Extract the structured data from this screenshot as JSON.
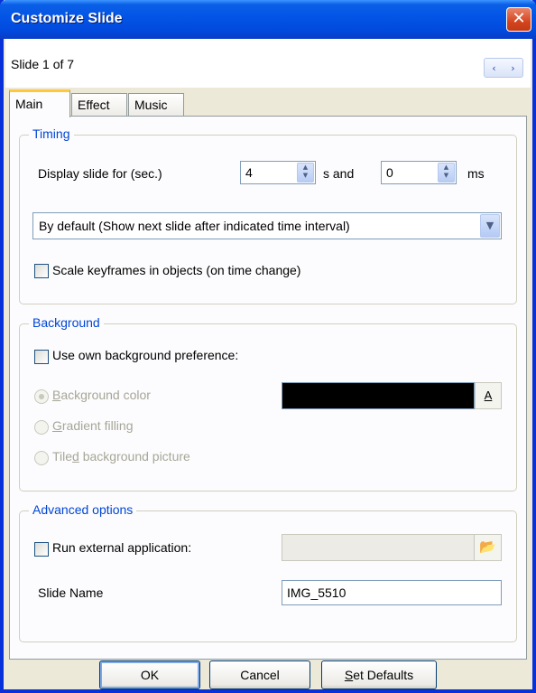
{
  "window": {
    "title": "Customize Slide",
    "close_glyph": "✕"
  },
  "slide_info": {
    "label": "Slide 1 of 7",
    "prev_glyph": "‹",
    "next_glyph": "›"
  },
  "tabs": [
    {
      "label": "Main",
      "active": true
    },
    {
      "label": "Effect",
      "active": false
    },
    {
      "label": "Music",
      "active": false
    }
  ],
  "timing": {
    "title": "Timing",
    "display_label": "Display slide for (sec.)",
    "seconds_value": "4",
    "seconds_unit": "s and",
    "ms_value": "0",
    "ms_unit": "ms",
    "mode_selected": "By default (Show next slide after indicated time interval)",
    "scale_keyframes_label": "Scale keyframes in objects (on time change)",
    "scale_keyframes_checked": false
  },
  "background": {
    "title": "Background",
    "use_own_label": "Use own background preference:",
    "use_own_checked": false,
    "options": [
      {
        "prefix": "",
        "accel": "B",
        "rest": "ackground color",
        "checked": true
      },
      {
        "prefix": "",
        "accel": "G",
        "rest": "radient filling",
        "checked": false
      },
      {
        "prefix": "Tile",
        "accel": "d",
        "rest": " background picture",
        "checked": false
      }
    ],
    "color_value": "#000000",
    "color_button_label": "A"
  },
  "advanced": {
    "title": "Advanced options",
    "run_external_label": "Run external application:",
    "run_external_checked": false,
    "external_path": "",
    "slide_name_label": "Slide Name",
    "slide_name_value": "IMG_5510"
  },
  "buttons": {
    "ok": "OK",
    "cancel": "Cancel",
    "set_defaults_accel": "S",
    "set_defaults_rest": "et Defaults"
  },
  "icons": {
    "browse": "folder-open-icon",
    "close": "close-icon",
    "dropdown": "chevron-down-icon"
  }
}
